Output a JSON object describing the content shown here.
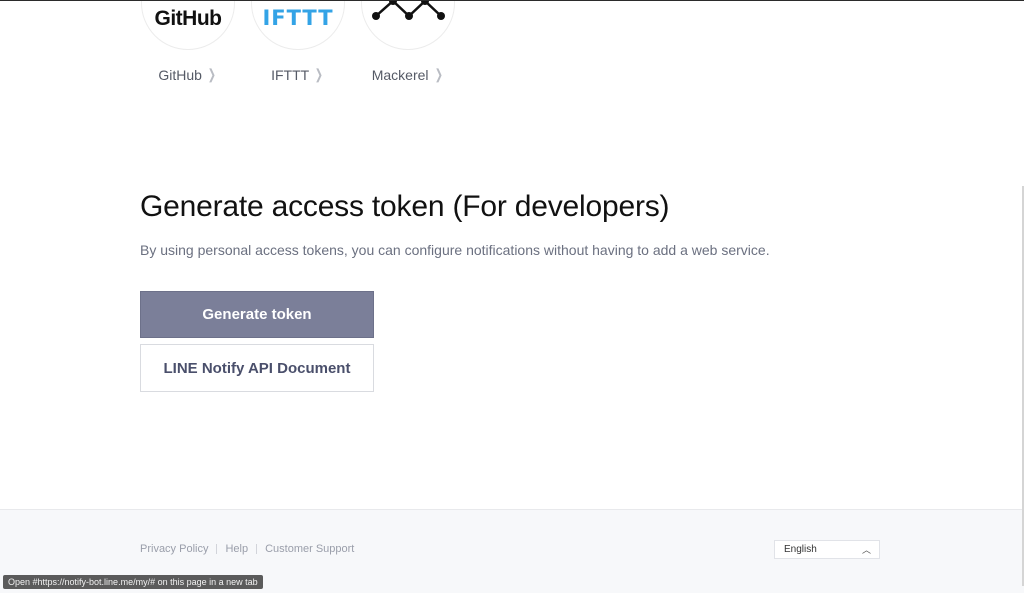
{
  "services": [
    {
      "name": "GitHub",
      "logo_text": "GitHub",
      "icon": "chevron-right-icon"
    },
    {
      "name": "IFTTT",
      "logo_text": "IFTTT",
      "icon": "chevron-right-icon"
    },
    {
      "name": "Mackerel",
      "logo_text": "",
      "icon": "chevron-right-icon"
    }
  ],
  "developer": {
    "title": "Generate access token (For developers)",
    "description": "By using personal access tokens, you can configure notifications without having to add a web service.",
    "generate_button": "Generate token",
    "api_doc_button": "LINE Notify API Document"
  },
  "footer": {
    "links": [
      "Privacy Policy",
      "Help",
      "Customer Support"
    ],
    "language": "English"
  },
  "status_bar": {
    "text": "Open #https://notify-bot.line.me/my/# on this page in a new tab"
  },
  "colors": {
    "primary_button": "#7b7f99",
    "ifttt_blue": "#33a3e6",
    "footer_bg": "#f7f8fa"
  }
}
